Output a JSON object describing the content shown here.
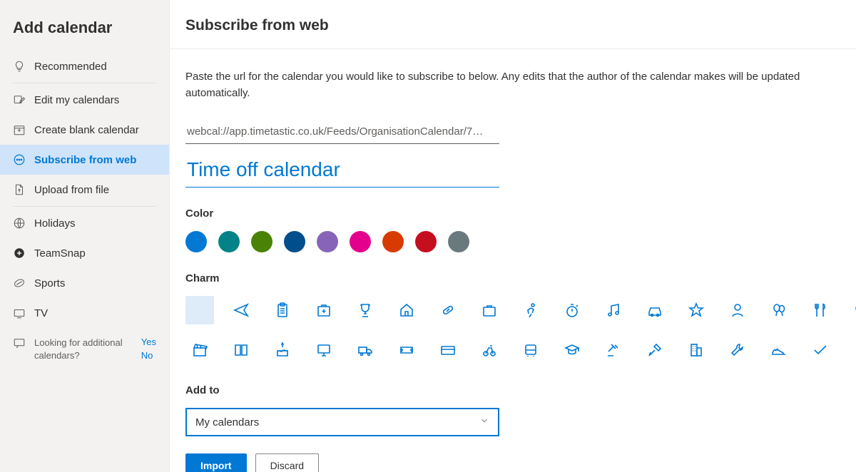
{
  "sidebar": {
    "title": "Add calendar",
    "items": [
      {
        "label": "Recommended"
      },
      {
        "label": "Edit my calendars"
      },
      {
        "label": "Create blank calendar"
      },
      {
        "label": "Subscribe from web"
      },
      {
        "label": "Upload from file"
      },
      {
        "label": "Holidays"
      },
      {
        "label": "TeamSnap"
      },
      {
        "label": "Sports"
      },
      {
        "label": "TV"
      }
    ],
    "feedback": {
      "text": "Looking for additional calendars?",
      "yes": "Yes",
      "no": "No"
    }
  },
  "main": {
    "title": "Subscribe from web",
    "description": "Paste the url for the calendar you would like to subscribe to below. Any edits that the author of the calendar makes will be updated automatically.",
    "url_value": "webcal://app.timetastic.co.uk/Feeds/OrganisationCalendar/7…",
    "name_value": "Time off calendar",
    "color_label": "Color",
    "colors": [
      "#0078d4",
      "#038387",
      "#498205",
      "#004e8c",
      "#8764b8",
      "#e3008c",
      "#d83b01",
      "#c50f1f",
      "#69797e"
    ],
    "charm_label": "Charm",
    "addto_label": "Add to",
    "addto_value": "My calendars",
    "import_label": "Import",
    "discard_label": "Discard"
  }
}
